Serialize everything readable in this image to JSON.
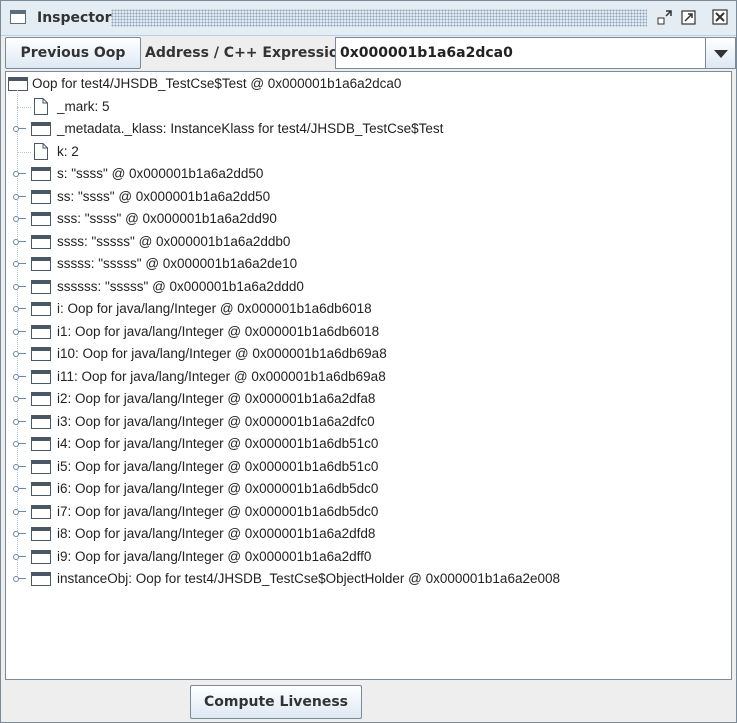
{
  "window": {
    "title": "Inspector",
    "controls": [
      "minimize-icon",
      "maximize-icon",
      "close-icon"
    ]
  },
  "toolbar": {
    "previous_label": "Previous Oop",
    "address_label": "Address / C++ Expression:",
    "address_value": "0x000001b1a6a2dca0"
  },
  "tree": {
    "root": "Oop for test4/JHSDB_TestCse$Test @ 0x000001b1a6a2dca0",
    "children": [
      {
        "text": "_mark: 5",
        "kind": "leaf"
      },
      {
        "text": "_metadata._klass: InstanceKlass for test4/JHSDB_TestCse$Test",
        "kind": "node"
      },
      {
        "text": "k: 2",
        "kind": "leaf"
      },
      {
        "text": "s: \"ssss\" @ 0x000001b1a6a2dd50",
        "kind": "node"
      },
      {
        "text": "ss: \"ssss\" @ 0x000001b1a6a2dd50",
        "kind": "node"
      },
      {
        "text": "sss: \"ssss\" @ 0x000001b1a6a2dd90",
        "kind": "node"
      },
      {
        "text": "ssss: \"sssss\" @ 0x000001b1a6a2ddb0",
        "kind": "node"
      },
      {
        "text": "sssss: \"sssss\" @ 0x000001b1a6a2de10",
        "kind": "node"
      },
      {
        "text": "ssssss: \"sssss\" @ 0x000001b1a6a2ddd0",
        "kind": "node"
      },
      {
        "text": "i: Oop for java/lang/Integer @ 0x000001b1a6db6018",
        "kind": "node"
      },
      {
        "text": "i1: Oop for java/lang/Integer @ 0x000001b1a6db6018",
        "kind": "node"
      },
      {
        "text": "i10: Oop for java/lang/Integer @ 0x000001b1a6db69a8",
        "kind": "node"
      },
      {
        "text": "i11: Oop for java/lang/Integer @ 0x000001b1a6db69a8",
        "kind": "node"
      },
      {
        "text": "i2: Oop for java/lang/Integer @ 0x000001b1a6a2dfa8",
        "kind": "node"
      },
      {
        "text": "i3: Oop for java/lang/Integer @ 0x000001b1a6a2dfc0",
        "kind": "node"
      },
      {
        "text": "i4: Oop for java/lang/Integer @ 0x000001b1a6db51c0",
        "kind": "node"
      },
      {
        "text": "i5: Oop for java/lang/Integer @ 0x000001b1a6db51c0",
        "kind": "node"
      },
      {
        "text": "i6: Oop for java/lang/Integer @ 0x000001b1a6db5dc0",
        "kind": "node"
      },
      {
        "text": "i7: Oop for java/lang/Integer @ 0x000001b1a6db5dc0",
        "kind": "node"
      },
      {
        "text": "i8: Oop for java/lang/Integer @ 0x000001b1a6a2dfd8",
        "kind": "node"
      },
      {
        "text": "i9: Oop for java/lang/Integer @ 0x000001b1a6a2dff0",
        "kind": "node"
      },
      {
        "text": "instanceObj: Oop for test4/JHSDB_TestCse$ObjectHolder @ 0x000001b1a6a2e008",
        "kind": "node"
      }
    ]
  },
  "bottom": {
    "compute_liveness_label": "Compute Liveness"
  }
}
